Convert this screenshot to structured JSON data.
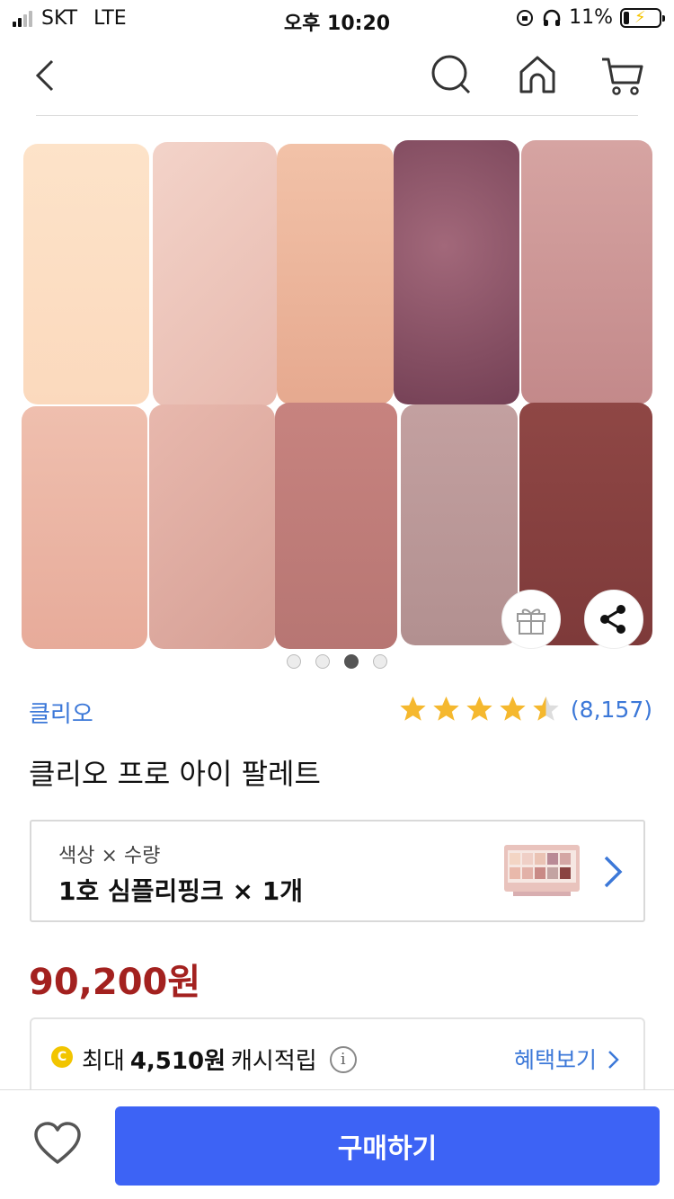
{
  "status_bar": {
    "carrier": "SKT",
    "network": "LTE",
    "time": "오후 10:20",
    "battery": "11%"
  },
  "nav": {
    "back_icon": "chevron-left-icon",
    "search_icon": "search-icon",
    "home_icon": "home-icon",
    "cart_icon": "cart-icon"
  },
  "gallery": {
    "page_count": 4,
    "active_index": 2
  },
  "product": {
    "brand": "클리오",
    "rating": 4.5,
    "review_count": "(8,157)",
    "title": "클리오 프로 아이 팔레트"
  },
  "option": {
    "label": "색상 × 수량",
    "value": "1호 심플리핑크 × 1개"
  },
  "price": "90,200원",
  "cash": {
    "coin": "C",
    "prefix": "최대",
    "amount": "4,510원",
    "suffix": "캐시적립",
    "info": "i",
    "benefit_link": "혜택보기"
  },
  "bottom": {
    "buy_label": "구매하기"
  },
  "colors": {
    "accent": "#3d63f5",
    "link": "#3c78d8",
    "price": "#a3211f",
    "star": "#f5b82e"
  }
}
